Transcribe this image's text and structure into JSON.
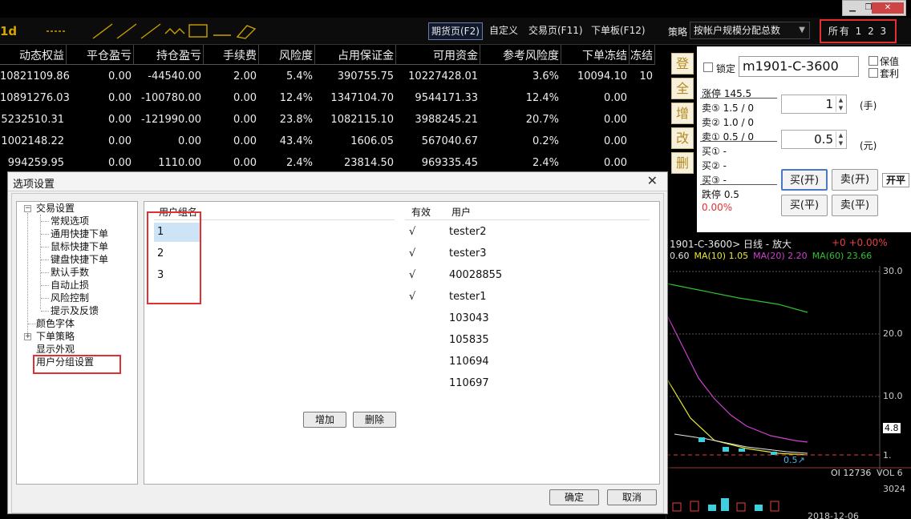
{
  "toolbar": {
    "logo": "1d",
    "tabs": [
      {
        "label": "期货页(F2)",
        "active": true
      },
      {
        "label": "自定义",
        "active": false
      },
      {
        "label": "交易页(F11)",
        "active": false
      },
      {
        "label": "下单板(F12)",
        "active": false
      }
    ],
    "strategy_label": "策略",
    "strategy_value": "按帐户规模分配总数",
    "group_selector": "所有 1 2 3"
  },
  "account_table": {
    "headers": [
      "动态权益",
      "平仓盈亏",
      "持仓盈亏",
      "手续费",
      "风险度",
      "占用保证金",
      "可用资金",
      "参考风险度",
      "下单冻结",
      "冻结"
    ],
    "rows": [
      [
        "10821109.86",
        "0.00",
        "-44540.00",
        "2.00",
        "5.4%",
        "390755.75",
        "10227428.01",
        "3.6%",
        "10094.10",
        "10"
      ],
      [
        "10891276.03",
        "0.00",
        "-100780.00",
        "0.00",
        "12.4%",
        "1347104.70",
        "9544171.33",
        "12.4%",
        "0.00",
        ""
      ],
      [
        "5232510.31",
        "0.00",
        "-121990.00",
        "0.00",
        "23.8%",
        "1082115.10",
        "3988245.21",
        "20.7%",
        "0.00",
        ""
      ],
      [
        "1002148.22",
        "0.00",
        "0.00",
        "0.00",
        "43.4%",
        "1606.05",
        "567040.67",
        "0.2%",
        "0.00",
        ""
      ],
      [
        "994259.95",
        "0.00",
        "1110.00",
        "0.00",
        "2.4%",
        "23814.50",
        "969335.45",
        "2.4%",
        "0.00",
        ""
      ]
    ]
  },
  "side_buttons": [
    "登",
    "全",
    "增",
    "改",
    "删"
  ],
  "order_panel": {
    "lock_label": "锁定",
    "symbol": "m1901-C-3600",
    "hedge_label": "保值",
    "arbitrage_label": "套利",
    "limit_up": "涨停 145.5",
    "asks": [
      "卖⑤ 1.5 / 0",
      "卖② 1.0 / 0",
      "卖① 0.5 / 0"
    ],
    "bids": [
      "买① -",
      "买② -",
      "买③ -"
    ],
    "limit_down": "跌停 0.5",
    "change_pct": "0.00%",
    "quantity": "1",
    "quantity_unit": "(手)",
    "price": "0.5",
    "price_unit": "(元)",
    "buy_open": "买(开)",
    "sell_open": "卖(开)",
    "buy_close": "买(平)",
    "sell_close": "卖(平)",
    "open_close": "开平"
  },
  "chart": {
    "title": "1901-C-3600> 日线 - 放大",
    "change": "+0  +0.00%",
    "ma_legend": [
      {
        "text": "0.60",
        "color": "#e8e8e8"
      },
      {
        "text": "MA(10) 1.05",
        "color": "#e8e830"
      },
      {
        "text": "MA(20) 2.20",
        "color": "#d040d0"
      },
      {
        "text": "MA(60) 23.66",
        "color": "#30c030"
      }
    ],
    "y_labels": [
      "30.0",
      "20.0",
      "10.0",
      "4.8",
      "1."
    ],
    "price_marker": "0.5↗",
    "oi_label": "OI 12736",
    "vol_label": "VOL 6",
    "vol_y": "3024",
    "date_label": "2018-12-06"
  },
  "dialog": {
    "title": "选项设置",
    "close": "✕",
    "tree": {
      "trade_settings": "交易设置",
      "trade_children": [
        "常规选项",
        "通用快捷下单",
        "鼠标快捷下单",
        "键盘快捷下单",
        "默认手数",
        "自动止损",
        "风险控制",
        "提示及反馈"
      ],
      "color_font": "颜色字体",
      "order_strategy": "下单策略",
      "display": "显示外观",
      "user_group": "用户分组设置"
    },
    "group_header": "用户组名",
    "groups": [
      "1",
      "2",
      "3"
    ],
    "user_headers": {
      "valid": "有效",
      "user": "用户"
    },
    "users": [
      {
        "valid": "√",
        "name": "tester2"
      },
      {
        "valid": "√",
        "name": "tester3"
      },
      {
        "valid": "√",
        "name": "40028855"
      },
      {
        "valid": "√",
        "name": "tester1"
      },
      {
        "valid": "",
        "name": "103043"
      },
      {
        "valid": "",
        "name": "105835"
      },
      {
        "valid": "",
        "name": "110694"
      },
      {
        "valid": "",
        "name": "110697"
      }
    ],
    "add_button": "增加",
    "delete_button": "删除",
    "ok_button": "确定",
    "cancel_button": "取消"
  },
  "colors": {
    "highlight": "#e23030",
    "accent": "#d4a400"
  }
}
